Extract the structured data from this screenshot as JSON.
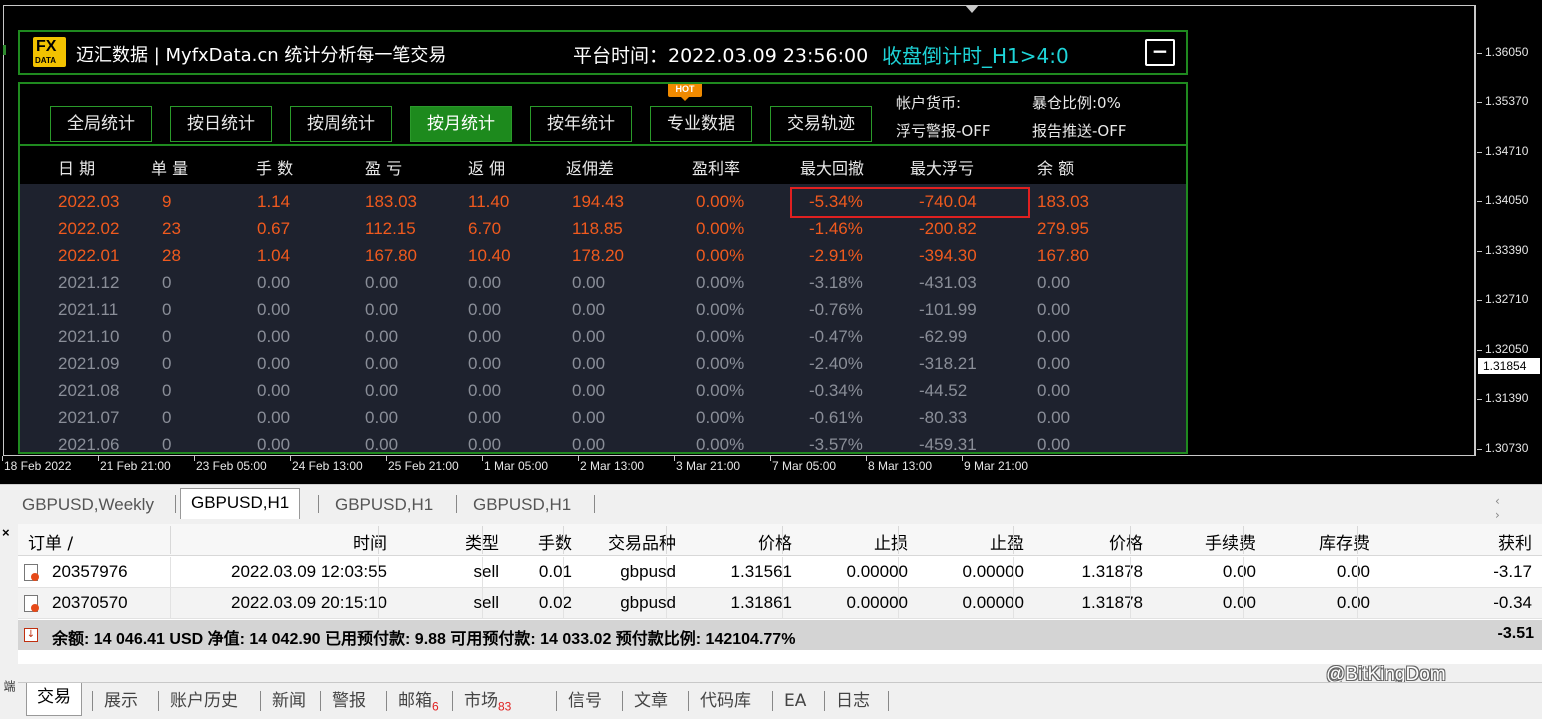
{
  "chart": {
    "price_labels": [
      "1.36050",
      "1.35370",
      "1.34710",
      "1.34050",
      "1.33390",
      "1.32710",
      "1.32050",
      "1.31390",
      "1.30730"
    ],
    "current_price": "1.31854",
    "time_labels": [
      "18 Feb 2022",
      "21 Feb 21:00",
      "23 Feb 05:00",
      "24 Feb 13:00",
      "25 Feb 21:00",
      "1 Mar 05:00",
      "2 Mar 13:00",
      "3 Mar 21:00",
      "7 Mar 05:00",
      "8 Mar 13:00",
      "9 Mar 21:00"
    ]
  },
  "fx_header": {
    "logo_big": "FX",
    "logo_small": "DATA",
    "title": "迈汇数据 | MyfxData.cn  统计分析每一笔交易",
    "platform_time": "平台时间：2022.03.09 23:56:00",
    "countdown": "收盘倒计时_H1>4:0",
    "minimize": "−"
  },
  "fx_tabs": [
    {
      "label": "全局统计",
      "active": false
    },
    {
      "label": "按日统计",
      "active": false
    },
    {
      "label": "按周统计",
      "active": false
    },
    {
      "label": "按月统计",
      "active": true
    },
    {
      "label": "按年统计",
      "active": false
    },
    {
      "label": "专业数据",
      "active": false
    },
    {
      "label": "交易轨迹",
      "active": false
    }
  ],
  "hot_badge": "HOT",
  "fx_info": {
    "currency": "帐户货币:",
    "margin_ratio": "暴仓比例:0%",
    "float_alert": "浮亏警报-OFF",
    "report_push": "报告推送-OFF"
  },
  "fx_columns": [
    "日 期",
    "单 量",
    "手 数",
    "盈 亏",
    "返 佣",
    "返佣差",
    "盈利率",
    "最大回撤",
    "最大浮亏",
    "余 额"
  ],
  "fx_rows": [
    {
      "active": true,
      "cells": [
        "2022.03",
        "9",
        "1.14",
        "183.03",
        "11.40",
        "194.43",
        "0.00%",
        "-5.34%",
        "-740.04",
        "183.03"
      ]
    },
    {
      "active": true,
      "cells": [
        "2022.02",
        "23",
        "0.67",
        "112.15",
        "6.70",
        "118.85",
        "0.00%",
        "-1.46%",
        "-200.82",
        "279.95"
      ]
    },
    {
      "active": true,
      "cells": [
        "2022.01",
        "28",
        "1.04",
        "167.80",
        "10.40",
        "178.20",
        "0.00%",
        "-2.91%",
        "-394.30",
        "167.80"
      ]
    },
    {
      "active": false,
      "cells": [
        "2021.12",
        "0",
        "0.00",
        "0.00",
        "0.00",
        "0.00",
        "0.00%",
        "-3.18%",
        "-431.03",
        "0.00"
      ]
    },
    {
      "active": false,
      "cells": [
        "2021.11",
        "0",
        "0.00",
        "0.00",
        "0.00",
        "0.00",
        "0.00%",
        "-0.76%",
        "-101.99",
        "0.00"
      ]
    },
    {
      "active": false,
      "cells": [
        "2021.10",
        "0",
        "0.00",
        "0.00",
        "0.00",
        "0.00",
        "0.00%",
        "-0.47%",
        "-62.99",
        "0.00"
      ]
    },
    {
      "active": false,
      "cells": [
        "2021.09",
        "0",
        "0.00",
        "0.00",
        "0.00",
        "0.00",
        "0.00%",
        "-2.40%",
        "-318.21",
        "0.00"
      ]
    },
    {
      "active": false,
      "cells": [
        "2021.08",
        "0",
        "0.00",
        "0.00",
        "0.00",
        "0.00",
        "0.00%",
        "-0.34%",
        "-44.52",
        "0.00"
      ]
    },
    {
      "active": false,
      "cells": [
        "2021.07",
        "0",
        "0.00",
        "0.00",
        "0.00",
        "0.00",
        "0.00%",
        "-0.61%",
        "-80.33",
        "0.00"
      ]
    },
    {
      "active": false,
      "cells": [
        "2021.06",
        "0",
        "0.00",
        "0.00",
        "0.00",
        "0.00",
        "0.00%",
        "-3.57%",
        "-459.31",
        "0.00"
      ]
    }
  ],
  "chart_tabs": [
    {
      "label": "GBPUSD,Weekly",
      "active": false
    },
    {
      "label": "GBPUSD,H1",
      "active": true
    },
    {
      "label": "GBPUSD,H1",
      "active": false
    },
    {
      "label": "GBPUSD,H1",
      "active": false
    }
  ],
  "tab_scroll": "‹ ›",
  "orders": {
    "close": "×",
    "columns": [
      "订单  /",
      "时间",
      "类型",
      "手数",
      "交易品种",
      "价格",
      "止损",
      "止盈",
      "价格",
      "手续费",
      "库存费",
      "获利"
    ],
    "rows": [
      [
        "20357976",
        "2022.03.09 12:03:55",
        "sell",
        "0.01",
        "gbpusd",
        "1.31561",
        "0.00000",
        "0.00000",
        "1.31878",
        "0.00",
        "0.00",
        "-3.17"
      ],
      [
        "20370570",
        "2022.03.09 20:15:10",
        "sell",
        "0.02",
        "gbpusd",
        "1.31861",
        "0.00000",
        "0.00000",
        "1.31878",
        "0.00",
        "0.00",
        "-0.34"
      ]
    ],
    "summary": "余额: 14 046.41 USD  净值: 14 042.90  已用预付款: 9.88  可用预付款: 14 033.02  预付款比例: 142104.77%",
    "summary_total": "-3.51"
  },
  "watermark": "@BitKingDom",
  "side_label": "端",
  "bottom_tabs": [
    {
      "label": "交易",
      "badge": "",
      "active": true
    },
    {
      "label": "展示",
      "badge": "",
      "active": false
    },
    {
      "label": "账户历史",
      "badge": "",
      "active": false
    },
    {
      "label": "新闻",
      "badge": "",
      "active": false
    },
    {
      "label": "警报",
      "badge": "",
      "active": false
    },
    {
      "label": "邮箱",
      "badge": "6",
      "active": false
    },
    {
      "label": "市场",
      "badge": "83",
      "active": false
    },
    {
      "label": "信号",
      "badge": "",
      "active": false
    },
    {
      "label": "文章",
      "badge": "",
      "active": false
    },
    {
      "label": "代码库",
      "badge": "",
      "active": false
    },
    {
      "label": "EA",
      "badge": "",
      "active": false
    },
    {
      "label": "日志",
      "badge": "",
      "active": false
    }
  ]
}
